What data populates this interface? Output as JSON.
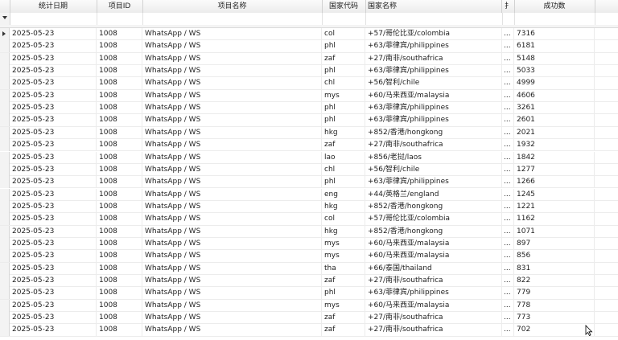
{
  "columns": [
    {
      "key": "date",
      "label": "统计日期"
    },
    {
      "key": "pid",
      "label": "项目ID"
    },
    {
      "key": "pname",
      "label": "项目名称"
    },
    {
      "key": "ccode",
      "label": "国家代码"
    },
    {
      "key": "cname",
      "label": "国家名称"
    },
    {
      "key": "extra",
      "label": "扌"
    },
    {
      "key": "success",
      "label": "成功数"
    }
  ],
  "rows": [
    {
      "date": "2025-05-23",
      "pid": "1008",
      "pname": "WhatsApp / WS",
      "ccode": "col",
      "cname": "+57/哥伦比亚/colombia",
      "extra": "...",
      "success": "7316"
    },
    {
      "date": "2025-05-23",
      "pid": "1008",
      "pname": "WhatsApp / WS",
      "ccode": "phl",
      "cname": "+63/菲律宾/philippines",
      "extra": "...",
      "success": "6181"
    },
    {
      "date": "2025-05-23",
      "pid": "1008",
      "pname": "WhatsApp / WS",
      "ccode": "zaf",
      "cname": "+27/南非/southafrica",
      "extra": "...",
      "success": "5148"
    },
    {
      "date": "2025-05-23",
      "pid": "1008",
      "pname": "WhatsApp / WS",
      "ccode": "phl",
      "cname": "+63/菲律宾/philippines",
      "extra": "...",
      "success": "5033"
    },
    {
      "date": "2025-05-23",
      "pid": "1008",
      "pname": "WhatsApp / WS",
      "ccode": "chl",
      "cname": "+56/智利/chile",
      "extra": "...",
      "success": "4999"
    },
    {
      "date": "2025-05-23",
      "pid": "1008",
      "pname": "WhatsApp / WS",
      "ccode": "mys",
      "cname": "+60/马来西亚/malaysia",
      "extra": "...",
      "success": "4606"
    },
    {
      "date": "2025-05-23",
      "pid": "1008",
      "pname": "WhatsApp / WS",
      "ccode": "phl",
      "cname": "+63/菲律宾/philippines",
      "extra": "...",
      "success": "3261"
    },
    {
      "date": "2025-05-23",
      "pid": "1008",
      "pname": "WhatsApp / WS",
      "ccode": "phl",
      "cname": "+63/菲律宾/philippines",
      "extra": "...",
      "success": "2601"
    },
    {
      "date": "2025-05-23",
      "pid": "1008",
      "pname": "WhatsApp / WS",
      "ccode": "hkg",
      "cname": "+852/香港/hongkong",
      "extra": "...",
      "success": "2021"
    },
    {
      "date": "2025-05-23",
      "pid": "1008",
      "pname": "WhatsApp / WS",
      "ccode": "zaf",
      "cname": "+27/南非/southafrica",
      "extra": "...",
      "success": "1932"
    },
    {
      "date": "2025-05-23",
      "pid": "1008",
      "pname": "WhatsApp / WS",
      "ccode": "lao",
      "cname": "+856/老挝/laos",
      "extra": "...",
      "success": "1842"
    },
    {
      "date": "2025-05-23",
      "pid": "1008",
      "pname": "WhatsApp / WS",
      "ccode": "chl",
      "cname": "+56/智利/chile",
      "extra": "...",
      "success": "1277"
    },
    {
      "date": "2025-05-23",
      "pid": "1008",
      "pname": "WhatsApp / WS",
      "ccode": "phl",
      "cname": "+63/菲律宾/philippines",
      "extra": "...",
      "success": "1266"
    },
    {
      "date": "2025-05-23",
      "pid": "1008",
      "pname": "WhatsApp / WS",
      "ccode": "eng",
      "cname": "+44/英格兰/england",
      "extra": "...",
      "success": "1245"
    },
    {
      "date": "2025-05-23",
      "pid": "1008",
      "pname": "WhatsApp / WS",
      "ccode": "hkg",
      "cname": "+852/香港/hongkong",
      "extra": "...",
      "success": "1221"
    },
    {
      "date": "2025-05-23",
      "pid": "1008",
      "pname": "WhatsApp / WS",
      "ccode": "col",
      "cname": "+57/哥伦比亚/colombia",
      "extra": "...",
      "success": "1162"
    },
    {
      "date": "2025-05-23",
      "pid": "1008",
      "pname": "WhatsApp / WS",
      "ccode": "hkg",
      "cname": "+852/香港/hongkong",
      "extra": "...",
      "success": "1071"
    },
    {
      "date": "2025-05-23",
      "pid": "1008",
      "pname": "WhatsApp / WS",
      "ccode": "mys",
      "cname": "+60/马来西亚/malaysia",
      "extra": "...",
      "success": "897"
    },
    {
      "date": "2025-05-23",
      "pid": "1008",
      "pname": "WhatsApp / WS",
      "ccode": "mys",
      "cname": "+60/马来西亚/malaysia",
      "extra": "...",
      "success": "856"
    },
    {
      "date": "2025-05-23",
      "pid": "1008",
      "pname": "WhatsApp / WS",
      "ccode": "tha",
      "cname": "+66/泰国/thailand",
      "extra": "...",
      "success": "831"
    },
    {
      "date": "2025-05-23",
      "pid": "1008",
      "pname": "WhatsApp / WS",
      "ccode": "zaf",
      "cname": "+27/南非/southafrica",
      "extra": "...",
      "success": "822"
    },
    {
      "date": "2025-05-23",
      "pid": "1008",
      "pname": "WhatsApp / WS",
      "ccode": "phl",
      "cname": "+63/菲律宾/philippines",
      "extra": "...",
      "success": "779"
    },
    {
      "date": "2025-05-23",
      "pid": "1008",
      "pname": "WhatsApp / WS",
      "ccode": "mys",
      "cname": "+60/马来西亚/malaysia",
      "extra": "...",
      "success": "778"
    },
    {
      "date": "2025-05-23",
      "pid": "1008",
      "pname": "WhatsApp / WS",
      "ccode": "zaf",
      "cname": "+27/南非/southafrica",
      "extra": "...",
      "success": "773"
    },
    {
      "date": "2025-05-23",
      "pid": "1008",
      "pname": "WhatsApp / WS",
      "ccode": "zaf",
      "cname": "+27/南非/southafrica",
      "extra": "...",
      "success": "702"
    }
  ],
  "colors": {
    "header_bg": "#ececec",
    "grid_line": "#ececec",
    "indicator_bg": "#f3f3f3"
  }
}
